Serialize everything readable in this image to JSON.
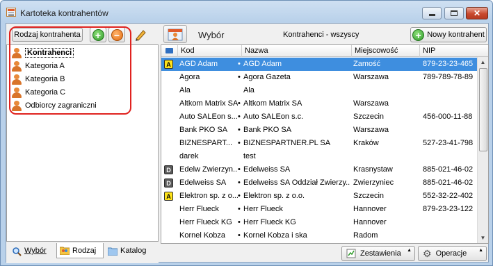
{
  "window": {
    "title": "Kartoteka kontrahentów",
    "min_icon": "minimize-icon",
    "max_icon": "maximize-icon",
    "close_icon": "close-icon"
  },
  "left": {
    "toolbar": {
      "category_type_label": "Rodzaj kontrahenta",
      "add_icon": "add-icon",
      "remove_icon": "remove-icon",
      "edit_icon": "pencil-icon"
    },
    "tree": {
      "items": [
        {
          "label": "Kontrahenci"
        },
        {
          "label": "Kategoria A"
        },
        {
          "label": "Kategoria B"
        },
        {
          "label": "Kategoria C"
        },
        {
          "label": "Odbiorcy zagraniczni"
        }
      ]
    },
    "tabs": [
      {
        "label": "Wybór"
      },
      {
        "label": "Rodzaj"
      },
      {
        "label": "Katalog"
      }
    ]
  },
  "right": {
    "header": {
      "select_label": "Wybór",
      "filter_title": "Kontrahenci - wszyscy",
      "new_button": "Nowy kontrahent"
    },
    "grid": {
      "columns": [
        "Kod",
        "Nazwa",
        "Miejscowość",
        "NIP"
      ],
      "rows": [
        {
          "badge": "A",
          "code": "AGD Adam",
          "dot": "•",
          "name": "AGD Adam",
          "city": "Zamość",
          "nip": "879-23-23-465",
          "selected": true
        },
        {
          "badge": "",
          "code": "Agora",
          "dot": "•",
          "name": "Agora Gazeta",
          "city": "Warszawa",
          "nip": "789-789-78-89"
        },
        {
          "badge": "",
          "code": "Ala",
          "dot": "",
          "name": "Ala",
          "city": "",
          "nip": ""
        },
        {
          "badge": "",
          "code": "Altkom Matrix SA",
          "dot": "•",
          "name": "Altkom Matrix SA",
          "city": "Warszawa",
          "nip": ""
        },
        {
          "badge": "",
          "code": "Auto SALEon s...",
          "dot": "•",
          "name": "Auto SALEon s.c.",
          "city": "Szczecin",
          "nip": "456-000-11-88"
        },
        {
          "badge": "",
          "code": "Bank PKO SA",
          "dot": "•",
          "name": "Bank PKO SA",
          "city": "Warszawa",
          "nip": ""
        },
        {
          "badge": "",
          "code": "BIZNESPART...",
          "dot": "•",
          "name": "BIZNESPARTNER.PL SA",
          "city": "Kraków",
          "nip": "527-23-41-798"
        },
        {
          "badge": "",
          "code": "darek",
          "dot": "",
          "name": "test",
          "city": "",
          "nip": ""
        },
        {
          "badge": "D",
          "code": "Edelw Zwierzyn...",
          "dot": "•",
          "name": "Edelweiss SA",
          "city": "Krasnystaw",
          "nip": "885-021-46-02"
        },
        {
          "badge": "D",
          "code": "Edelweiss SA",
          "dot": "•",
          "name": "Edelweiss SA Oddział Zwierzy...",
          "city": "Zwierzyniec",
          "nip": "885-021-46-02"
        },
        {
          "badge": "A",
          "code": "Elektron sp. z o...",
          "dot": "•",
          "name": "Elektron sp. z o.o.",
          "city": "Szczecin",
          "nip": "552-32-22-402"
        },
        {
          "badge": "",
          "code": "Herr Flueck",
          "dot": "•",
          "name": "Herr Flueck",
          "city": "Hannover",
          "nip": "879-23-23-122"
        },
        {
          "badge": "",
          "code": "Herr Flueck KG",
          "dot": "•",
          "name": "Herr Flueck KG",
          "city": "Hannover",
          "nip": ""
        },
        {
          "badge": "",
          "code": "Kornel Kobza",
          "dot": "•",
          "name": "Kornel Kobza i ska",
          "city": "Radom",
          "nip": ""
        }
      ]
    },
    "bottom": {
      "summaries_button": "Zestawienia",
      "operations_button": "Operacje"
    }
  },
  "colors": {
    "selection": "#3e8edf",
    "highlight_outline": "#e0221f",
    "badge_A": "#ffe31a",
    "badge_D": "#5a5a5a"
  }
}
